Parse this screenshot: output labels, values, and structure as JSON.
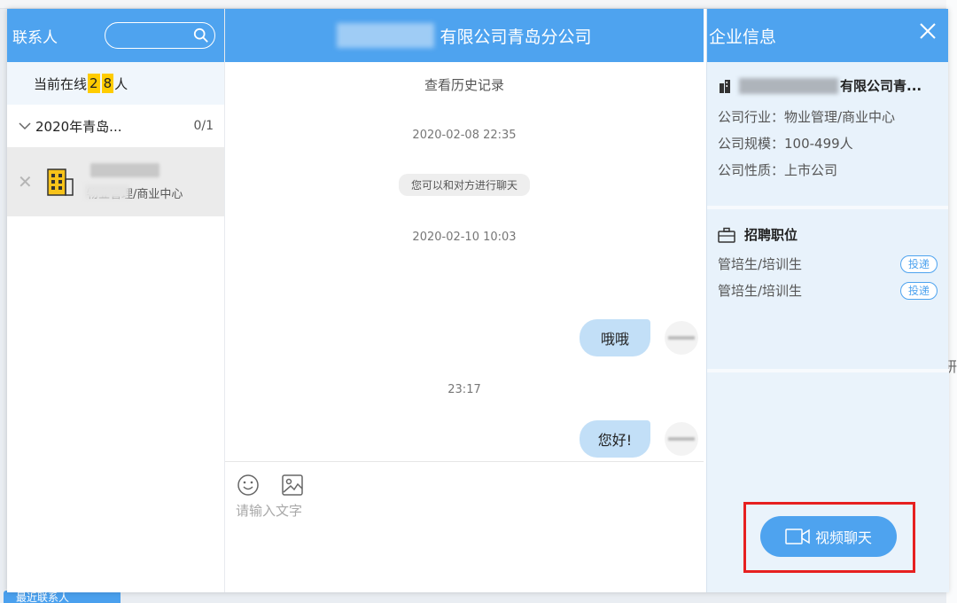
{
  "background": {
    "bottom_tab_label": "最近联系人",
    "right_fragment": "研"
  },
  "left_panel": {
    "title": "联系人",
    "search_placeholder": "",
    "online": {
      "prefix": "当前在线",
      "digit1": "2",
      "digit2": "8",
      "suffix": "人"
    },
    "group": {
      "name": "2020年青岛...",
      "count": "0/1"
    },
    "contact": {
      "subtitle": "物业管理/商业中心"
    }
  },
  "chat": {
    "title_suffix": "有限公司青岛分公司",
    "history_link": "查看历史记录",
    "timestamp_1": "2020-02-08 22:35",
    "system_message": "您可以和对方进行聊天",
    "timestamp_2": "2020-02-10 10:03",
    "message_1": "哦哦",
    "timestamp_3": "23:17",
    "message_2": "您好!",
    "input_placeholder": "请输入文字"
  },
  "company_panel": {
    "title": "企业信息",
    "company_name_suffix": "有限公司青...",
    "industry": "公司行业：物业管理/商业中心",
    "size": "公司规模：100-499人",
    "nature": "公司性质：上市公司",
    "jobs_title": "招聘职位",
    "jobs": [
      {
        "name": "管培生/培训生",
        "action": "投递"
      },
      {
        "name": "管培生/培训生",
        "action": "投递"
      }
    ],
    "video_chat_label": "视频聊天"
  },
  "colors": {
    "accent": "#4ea3ef",
    "bubble": "#c2dff7",
    "highlight": "#e62020",
    "online_digit_bg": "#ffcc00"
  }
}
